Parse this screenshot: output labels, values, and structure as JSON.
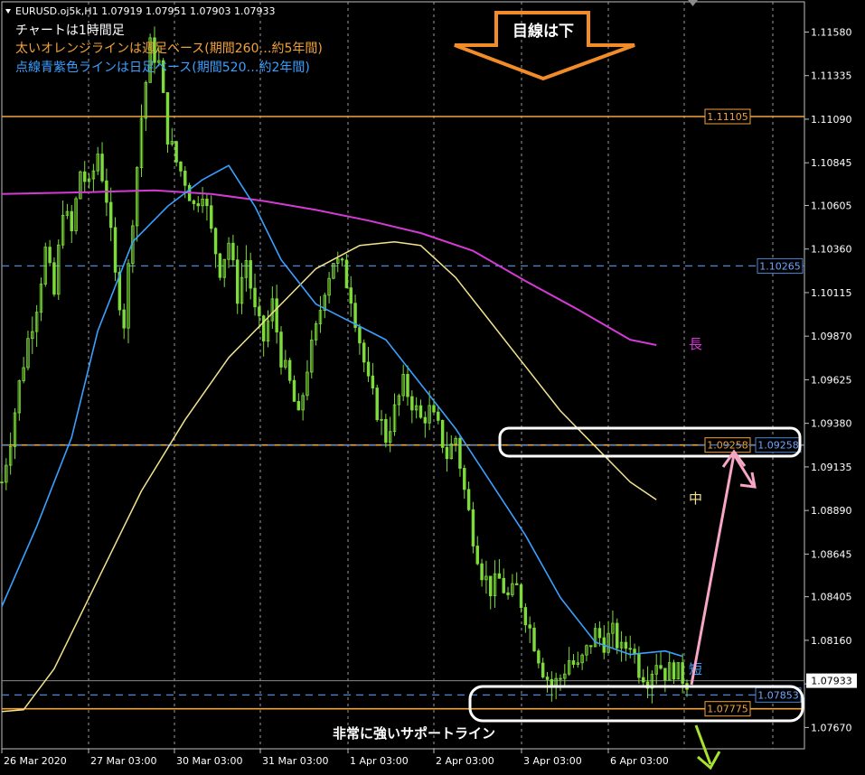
{
  "header": {
    "symbol_line": "EURUSD.oj5k,H1  1.07919 1.07951 1.07903 1.07933",
    "note1": "チャートは1時間足",
    "note2": "太いオレンジラインは週足ベース(期間260…約5年間)",
    "note3": "点線青紫色ラインは日足ベース(期間520…約2年間)"
  },
  "callouts": {
    "direction": "目線は下",
    "support": "非常に強いサポートライン",
    "ma_long": "長",
    "ma_mid": "中",
    "ma_short": "短"
  },
  "colors": {
    "background": "#000000",
    "grid": "#9a9a9a",
    "candle": "#7ddc3a",
    "orange_line": "#f2a23a",
    "blue_dashed": "#4e86d6",
    "ma_short": "#3aa0ff",
    "ma_mid": "#f3e38d",
    "ma_long": "#d43ad4",
    "arrow_pink": "#f7a6c5",
    "arrow_green": "#a7e22e",
    "arrow_orange": "#f28c28",
    "white_box": "#ffffff"
  },
  "chart_data": {
    "type": "candlestick",
    "symbol": "EURUSD.oj5k",
    "timeframe": "H1",
    "ohlc_current": {
      "open": 1.07919,
      "high": 1.07951,
      "low": 1.07903,
      "close": 1.07933
    },
    "ylim": [
      1.0755,
      1.1175
    ],
    "y_ticks": [
      1.1158,
      1.11335,
      1.1109,
      1.10845,
      1.10605,
      1.1036,
      1.10115,
      1.0987,
      1.09625,
      1.0938,
      1.09135,
      1.0889,
      1.08645,
      1.08405,
      1.0816,
      1.07915,
      1.0767
    ],
    "y_tick_labels": [
      "1.11580",
      "1.11335",
      "1.11090",
      "1.10845",
      "1.10605",
      "1.10360",
      "1.10115",
      "1.09870",
      "1.09625",
      "1.09380",
      "1.09135",
      "1.08890",
      "1.08645",
      "1.08405",
      "1.08160",
      "1.07915",
      "1.07670"
    ],
    "x_labels": [
      "26 Mar 2020",
      "27 Mar 03:00",
      "30 Mar 03:00",
      "31 Mar 03:00",
      "1 Apr 03:00",
      "2 Apr 03:00",
      "3 Apr 03:00",
      "6 Apr 03:00"
    ],
    "current_price": 1.07933,
    "current_price_label": "1.07933",
    "horizontal_levels": [
      {
        "value": 1.11105,
        "label": "1.11105",
        "style": "orange-solid"
      },
      {
        "value": 1.10265,
        "label": "1.10265",
        "style": "blue-dashed"
      },
      {
        "value": 1.09258,
        "label": "1.09258",
        "style": "orange-solid"
      },
      {
        "value": 1.09258,
        "label": "1.09258",
        "style": "blue-dashed"
      },
      {
        "value": 1.07853,
        "label": "1.07853",
        "style": "blue-dashed"
      },
      {
        "value": 1.07775,
        "label": "1.07775",
        "style": "orange-solid"
      }
    ],
    "path_points": [
      [
        0,
        1.0905
      ],
      [
        2,
        1.093
      ],
      [
        4,
        1.096
      ],
      [
        6,
        1.0985
      ],
      [
        8,
        1.1005
      ],
      [
        10,
        1.1035
      ],
      [
        12,
        1.101
      ],
      [
        14,
        1.106
      ],
      [
        16,
        1.1045
      ],
      [
        18,
        1.108
      ],
      [
        20,
        1.107
      ],
      [
        22,
        1.109
      ],
      [
        24,
        1.1065
      ],
      [
        26,
        1.102
      ],
      [
        28,
        1.0995
      ],
      [
        30,
        1.1055
      ],
      [
        32,
        1.111
      ],
      [
        34,
        1.115
      ],
      [
        36,
        1.114
      ],
      [
        38,
        1.11
      ],
      [
        40,
        1.1085
      ],
      [
        42,
        1.1075
      ],
      [
        44,
        1.106
      ],
      [
        46,
        1.107
      ],
      [
        48,
        1.1045
      ],
      [
        50,
        1.1025
      ],
      [
        52,
        1.104
      ],
      [
        54,
        1.101
      ],
      [
        56,
        1.103
      ],
      [
        58,
        1.1
      ],
      [
        60,
        1.0985
      ],
      [
        62,
        1.1005
      ],
      [
        64,
        1.0975
      ],
      [
        66,
        1.096
      ],
      [
        68,
        1.094
      ],
      [
        70,
        1.097
      ],
      [
        72,
        1.099
      ],
      [
        74,
        1.1015
      ],
      [
        76,
        1.103
      ],
      [
        78,
        1.1025
      ],
      [
        80,
        1.101
      ],
      [
        82,
        1.0985
      ],
      [
        84,
        1.096
      ],
      [
        86,
        1.0945
      ],
      [
        88,
        1.093
      ],
      [
        90,
        1.0945
      ],
      [
        92,
        1.096
      ],
      [
        94,
        1.095
      ],
      [
        96,
        1.094
      ],
      [
        98,
        1.0945
      ],
      [
        100,
        1.0935
      ],
      [
        102,
        1.092
      ],
      [
        104,
        1.093
      ],
      [
        106,
        1.09
      ],
      [
        108,
        1.0875
      ],
      [
        110,
        1.0855
      ],
      [
        112,
        1.0845
      ],
      [
        114,
        1.085
      ],
      [
        116,
        1.084
      ],
      [
        118,
        1.0845
      ],
      [
        120,
        1.083
      ],
      [
        122,
        1.0815
      ],
      [
        124,
        1.08
      ],
      [
        126,
        1.079
      ],
      [
        128,
        1.0795
      ],
      [
        130,
        1.0805
      ],
      [
        132,
        1.08
      ],
      [
        134,
        1.081
      ],
      [
        136,
        1.082
      ],
      [
        138,
        1.0815
      ],
      [
        140,
        1.082
      ],
      [
        142,
        1.081
      ],
      [
        144,
        1.0815
      ],
      [
        146,
        1.08
      ],
      [
        148,
        1.0795
      ],
      [
        150,
        1.0805
      ],
      [
        152,
        1.0798
      ],
      [
        154,
        1.08
      ],
      [
        156,
        1.0795
      ],
      [
        157,
        1.0793
      ]
    ],
    "ma_short": [
      [
        0,
        1.0835
      ],
      [
        8,
        1.088
      ],
      [
        16,
        1.093
      ],
      [
        22,
        1.099
      ],
      [
        30,
        1.104
      ],
      [
        38,
        1.106
      ],
      [
        46,
        1.1075
      ],
      [
        52,
        1.1083
      ],
      [
        58,
        1.106
      ],
      [
        64,
        1.103
      ],
      [
        72,
        1.1005
      ],
      [
        80,
        1.0995
      ],
      [
        88,
        1.0985
      ],
      [
        96,
        1.096
      ],
      [
        104,
        1.0935
      ],
      [
        112,
        1.0905
      ],
      [
        120,
        1.0875
      ],
      [
        128,
        1.084
      ],
      [
        136,
        1.0815
      ],
      [
        144,
        1.0808
      ],
      [
        152,
        1.081
      ],
      [
        156,
        1.0807
      ]
    ],
    "ma_mid": [
      [
        0,
        1.0776
      ],
      [
        5,
        1.0777
      ],
      [
        12,
        1.08
      ],
      [
        22,
        1.085
      ],
      [
        32,
        1.09
      ],
      [
        42,
        1.094
      ],
      [
        52,
        1.0975
      ],
      [
        62,
        1.1
      ],
      [
        72,
        1.1025
      ],
      [
        82,
        1.1038
      ],
      [
        90,
        1.104
      ],
      [
        96,
        1.1038
      ],
      [
        104,
        1.102
      ],
      [
        112,
        1.0995
      ],
      [
        120,
        1.097
      ],
      [
        128,
        1.0945
      ],
      [
        136,
        1.0925
      ],
      [
        144,
        1.0905
      ],
      [
        150,
        1.0895
      ]
    ],
    "ma_long": [
      [
        0,
        1.1067
      ],
      [
        20,
        1.1068
      ],
      [
        35,
        1.1069
      ],
      [
        48,
        1.1067
      ],
      [
        60,
        1.1063
      ],
      [
        72,
        1.1058
      ],
      [
        84,
        1.1052
      ],
      [
        96,
        1.1045
      ],
      [
        108,
        1.1035
      ],
      [
        120,
        1.1018
      ],
      [
        132,
        1.1002
      ],
      [
        144,
        1.0985
      ],
      [
        150,
        1.0982
      ]
    ]
  }
}
